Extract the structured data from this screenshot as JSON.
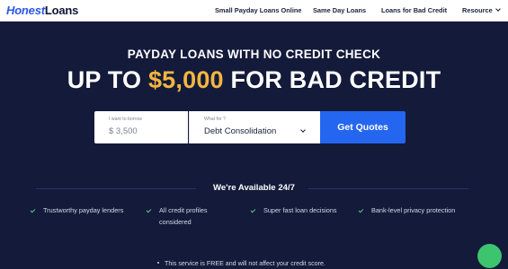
{
  "header": {
    "logo_part1": "Honest",
    "logo_part2": "Loans",
    "nav": [
      {
        "label": "Small Payday Loans Online"
      },
      {
        "label": "Same Day Loans"
      },
      {
        "label": "Loans for Bad Credit"
      },
      {
        "label": "Resource",
        "has_dropdown": true
      }
    ]
  },
  "hero": {
    "subhead": "PAYDAY LOANS WITH NO CREDIT CHECK",
    "headline_prefix": "UP TO ",
    "headline_amount": "$5,000",
    "headline_suffix": " FOR BAD CREDIT"
  },
  "form": {
    "borrow_label": "I want to borrow",
    "borrow_value": "$ 3,500",
    "purpose_label": "What for ?",
    "purpose_value": "Debt Consolidation",
    "submit_label": "Get Quotes"
  },
  "availability": {
    "title": "We're Available 24/7",
    "features": [
      {
        "text": "Trustworthy payday lenders"
      },
      {
        "text": "All credit profiles considered"
      },
      {
        "text": "Super fast loan decisions"
      },
      {
        "text": "Bank-level privacy protection"
      }
    ],
    "note": "This service is FREE and will not affect your credit score."
  },
  "colors": {
    "background": "#131a3a",
    "accent_amount": "#f5b53f",
    "button": "#2466f0",
    "check": "#5ac98a",
    "chat": "#3cc46e"
  },
  "icons": {
    "check": "check-icon",
    "dropdown": "chevron-down-icon",
    "chat": "chat-icon"
  }
}
